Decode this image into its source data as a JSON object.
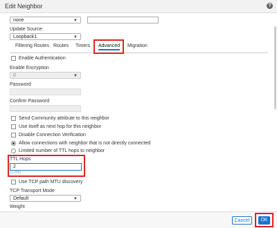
{
  "dialog": {
    "title": "Edit Neighbor"
  },
  "top": {
    "select_value": "none",
    "text_value": ""
  },
  "update_source": {
    "label": "Update Source:",
    "value": "Loopback1"
  },
  "tabs": [
    "Filtering Routes",
    "Routes",
    "Timers",
    "Advanced",
    "Migration"
  ],
  "advanced": {
    "enable_auth_label": "Enable Authentication",
    "enable_encryption_label": "Enable Encryption",
    "encryption_value": "0",
    "password_label": "Password",
    "confirm_password_label": "Confirm Password",
    "send_community_label": "Send Community attribute to this neighbor",
    "next_hop_label": "Use itself as next hop for this neighbor",
    "disable_conn_verif_label": "Disable Connection Verification",
    "allow_connections_label": "Allow connections with neighbor that is not directly connected",
    "limited_ttl_label": "Limited number of TTL hops to neighbor",
    "ttl_hops_label": "TTL Hops",
    "ttl_hops_value": "2",
    "ttl_hops_hint": "(1-255)",
    "tcp_mtu_label": "Use TCP path MTU discovery",
    "tcp_transport_label": "TCP Transport Mode",
    "tcp_transport_value": "Default",
    "weight_label": "Weight"
  },
  "footer": {
    "cancel_label": "Cancel",
    "ok_label": "OK"
  },
  "colors": {
    "accent": "#1a73c9",
    "highlight": "#dd2222"
  }
}
